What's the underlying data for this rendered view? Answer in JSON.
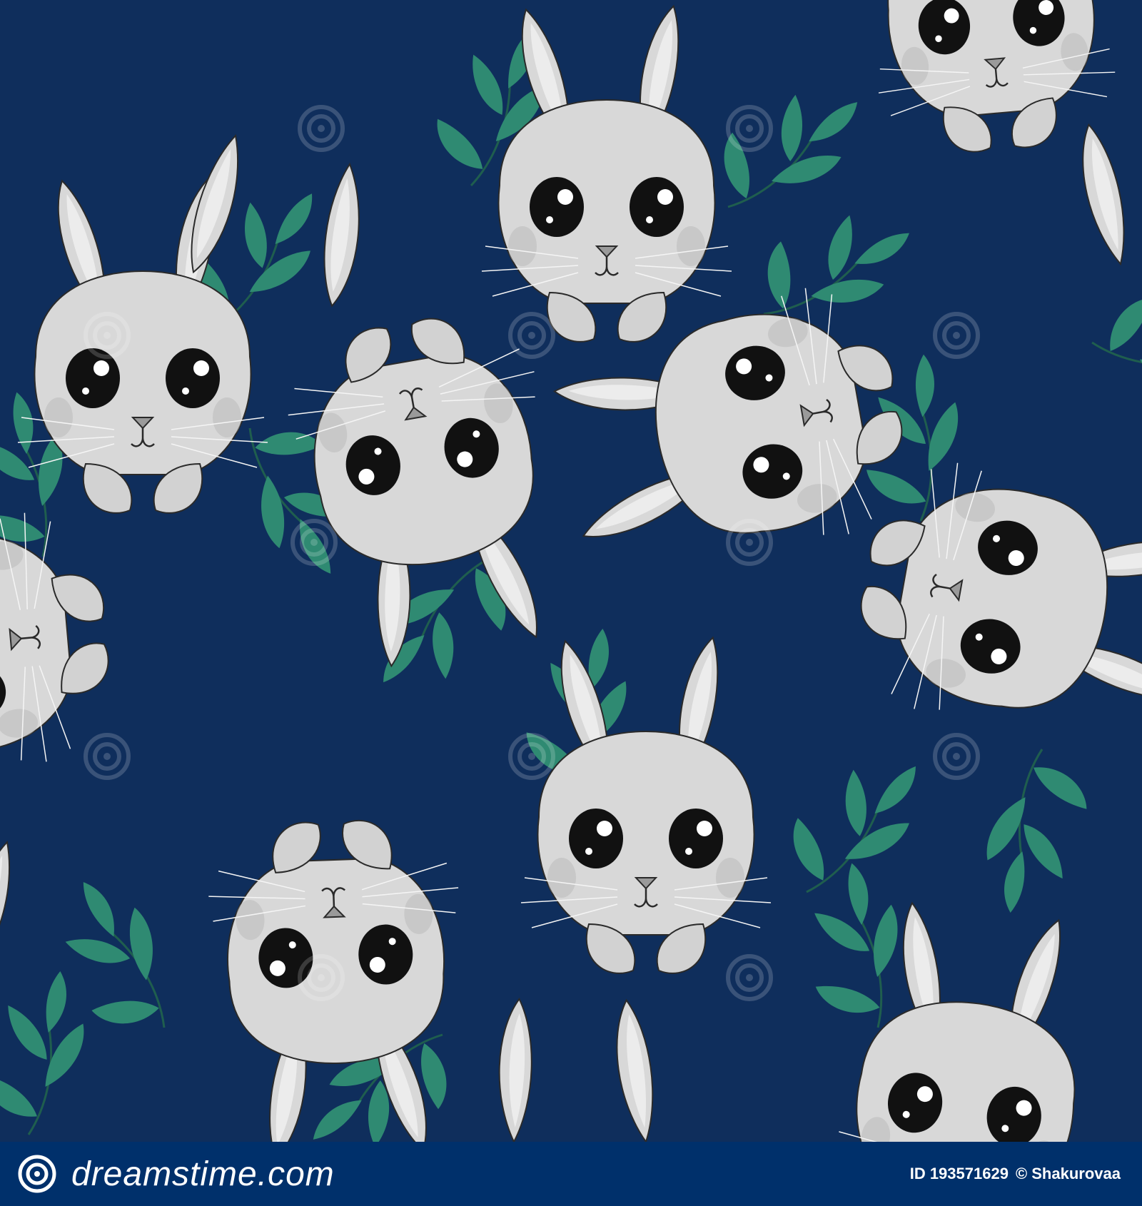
{
  "image": {
    "subject": "seamless-pattern-grey-bunnies-with-green-leaves",
    "colors": {
      "background": "#0f2e5c",
      "fur": "#d8d8d8",
      "fur_shadow": "#b3b3b3",
      "outline": "#2a2a2a",
      "leaf": "#2f8a72",
      "footer": "#00306b"
    }
  },
  "footer": {
    "logo_icon": "dreamstime-spiral-logo-icon",
    "brand_text": "dreamstime.com",
    "image_id": "ID 193571629",
    "author": "© Shakurovaa"
  }
}
